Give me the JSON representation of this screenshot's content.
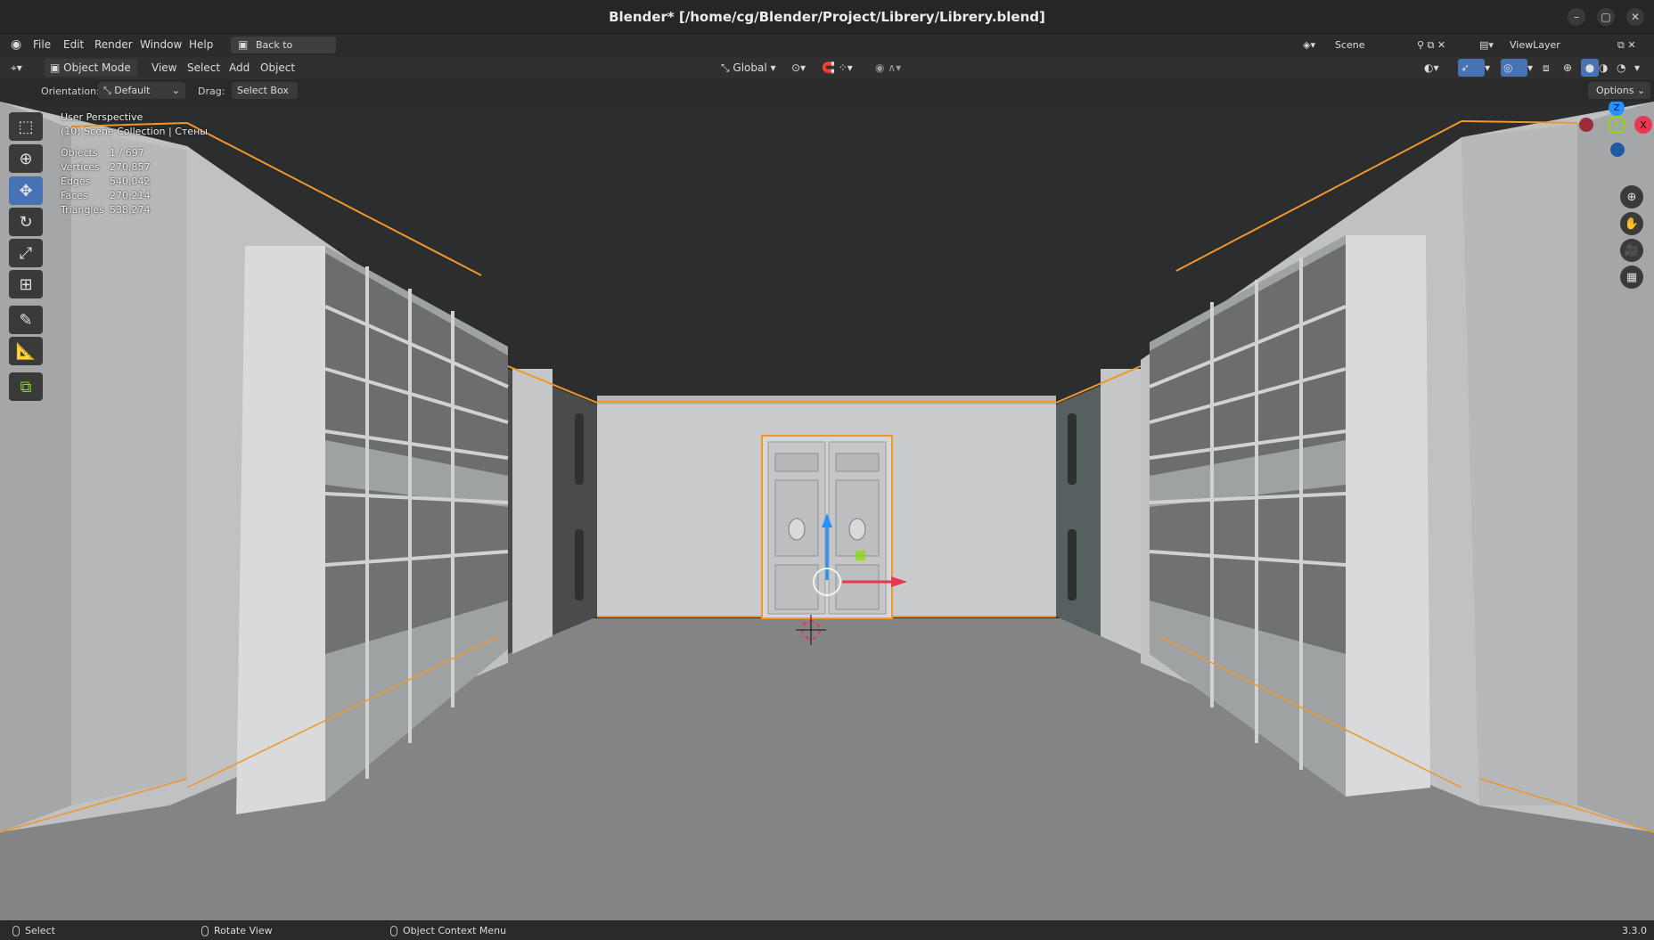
{
  "window": {
    "title": "Blender* [/home/cg/Blender/Project/Librery/Librery.blend]"
  },
  "menu": {
    "items": [
      "File",
      "Edit",
      "Render",
      "Window",
      "Help"
    ],
    "back_button": "Back to Previous",
    "scene": "Scene",
    "view_layer": "ViewLayer"
  },
  "header": {
    "mode": "Object Mode",
    "menus": [
      "View",
      "Select",
      "Add",
      "Object"
    ],
    "transform_orientation": "Global",
    "options_label": "Options"
  },
  "tool_settings": {
    "orientation_label": "Orientation:",
    "orientation_value": "Default",
    "drag_label": "Drag:",
    "drag_value": "Select Box"
  },
  "overlay": {
    "view_name": "User Perspective",
    "collection": "(10) Scene Collection | Стены",
    "stats": [
      {
        "label": "Objects",
        "value": "1 / 697"
      },
      {
        "label": "Vertices",
        "value": "270,857"
      },
      {
        "label": "Edges",
        "value": "540,042"
      },
      {
        "label": "Faces",
        "value": "270,214"
      },
      {
        "label": "Triangles",
        "value": "538,274"
      }
    ]
  },
  "toolbar_icons": [
    "select-box-icon",
    "cursor-icon",
    "move-icon",
    "rotate-icon",
    "scale-icon",
    "transform-icon",
    "annotate-icon",
    "measure-icon",
    "add-cube-icon"
  ],
  "gizmo": {
    "z": "Z",
    "y": "Y",
    "x": "X"
  },
  "statusbar": {
    "select": "Select",
    "rotate": "Rotate View",
    "context": "Object Context Menu",
    "version": "3.3.0"
  },
  "colors": {
    "accent": "#4772b3",
    "selection": "#f0962a",
    "x_axis": "#e8384f",
    "y_axis": "#8bdc00",
    "z_axis": "#2890ff"
  }
}
